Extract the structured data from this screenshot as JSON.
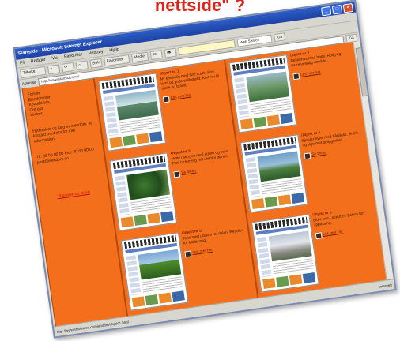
{
  "headline": "nettside\" ?",
  "window": {
    "title": "Startside - Microsoft Internet Explorer",
    "controls": [
      "_",
      "□",
      "×"
    ]
  },
  "menubar": [
    "Fil",
    "Rediger",
    "Vis",
    "Favoritter",
    "Verktøy",
    "Hjelp"
  ],
  "toolbar": {
    "back_label": "Tilbake",
    "buttons": [
      "×",
      "⟳",
      "⌂",
      "Søk",
      "Favoritter",
      "Medier",
      "✉",
      "🖶"
    ],
    "search_select": "Web Search",
    "go_label": "Gå"
  },
  "addressbar": {
    "label": "Adresse",
    "url": "http://www.startsiden.no/",
    "go_label": "Gå"
  },
  "left": {
    "block1": [
      "Forside",
      "Eiendommer",
      "Kontakt oss",
      "Om oss",
      "Lenker"
    ],
    "block2": "Hytteutleie og salg av eiendom. Ta kontakt med oss for mer informasjon.",
    "block3": "Tlf: 00 00 00 00  Fax: 00 00 00 00  post@eiendom.no",
    "link": "Til toppen av siden"
  },
  "columns": [
    {
      "entries": [
        {
          "photo": "p-building",
          "title": "Objekt nr 1",
          "text": "Ny enebolig med flott utsikt. Stor tomt og gode solforhold. Kort vei til skole og butikk.",
          "link": "Les mer her"
        },
        {
          "photo": "p-forest",
          "title": "Objekt nr 3",
          "text": "Hytte i skogen med strøm og vann. Flott turterreng rett utenfor døren.",
          "link": "Se bilder"
        },
        {
          "photo": "p-hills",
          "title": "Objekt nr 5",
          "text": "Tomt med utsikt over dalen. Regulert for fritidsbolig.",
          "link": "Les mer her"
        }
      ]
    },
    {
      "entries": [
        {
          "photo": "p-garden",
          "title": "Objekt nr 2",
          "text": "Rekkehus med hage. Rolig og barnevennlig område.",
          "link": "Les mer her"
        },
        {
          "photo": "p-lake",
          "title": "Objekt nr 4",
          "text": "Sjønær hytte med båtplass. Solrik og skjermet beliggenhet.",
          "link": "Se bilder"
        },
        {
          "photo": "p-house",
          "title": "Objekt nr 6",
          "text": "Eldre hus i sentrum. Behov for oppussing.",
          "link": "Les mer her"
        }
      ]
    }
  ],
  "statusbar": {
    "text": "http://www.startsiden.no/eiendom/objekt1.html",
    "zone": "Internett"
  },
  "colors": {
    "page_bg": "#f46f1c",
    "headline": "#d9261c",
    "titlebar": "#1d42a4"
  }
}
